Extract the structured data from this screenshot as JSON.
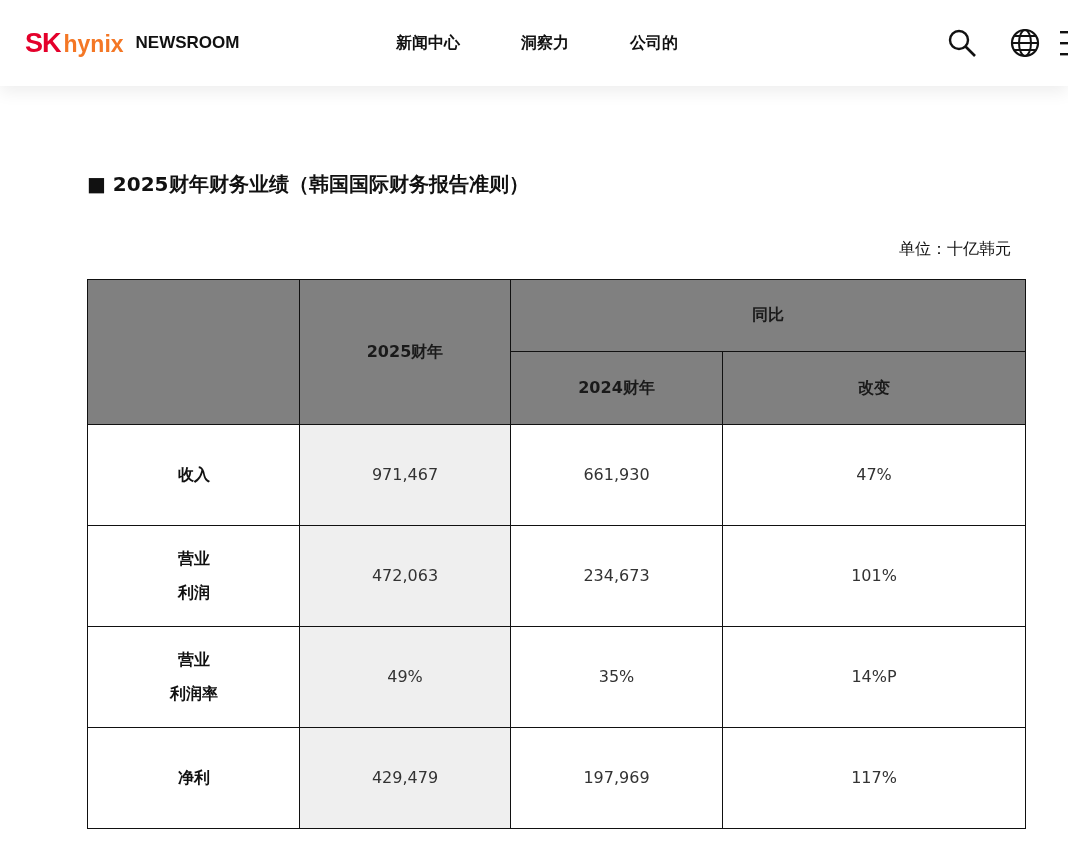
{
  "header": {
    "logo_sk": "SK",
    "logo_hynix": "hynix",
    "site": "NEWSROOM",
    "nav": [
      "新闻中心",
      "洞察力",
      "公司的"
    ]
  },
  "section_title": "■ 2025财年财务业绩（韩国国际财务报告准则）",
  "unit": "单位：十亿韩元",
  "table": {
    "col_current": "2025财年",
    "group": "同比",
    "col_previous": "2024财年",
    "col_change": "改变",
    "rows": [
      {
        "label": [
          "收入"
        ],
        "current": "971,467",
        "previous": "661,930",
        "change": "47%"
      },
      {
        "label": [
          "营业",
          "利润"
        ],
        "current": "472,063",
        "previous": "234,673",
        "change": "101%"
      },
      {
        "label": [
          "营业",
          "利润率"
        ],
        "current": "49%",
        "previous": "35%",
        "change": "14%P"
      },
      {
        "label": [
          "净利"
        ],
        "current": "429,479",
        "previous": "197,969",
        "change": "117%"
      }
    ]
  }
}
